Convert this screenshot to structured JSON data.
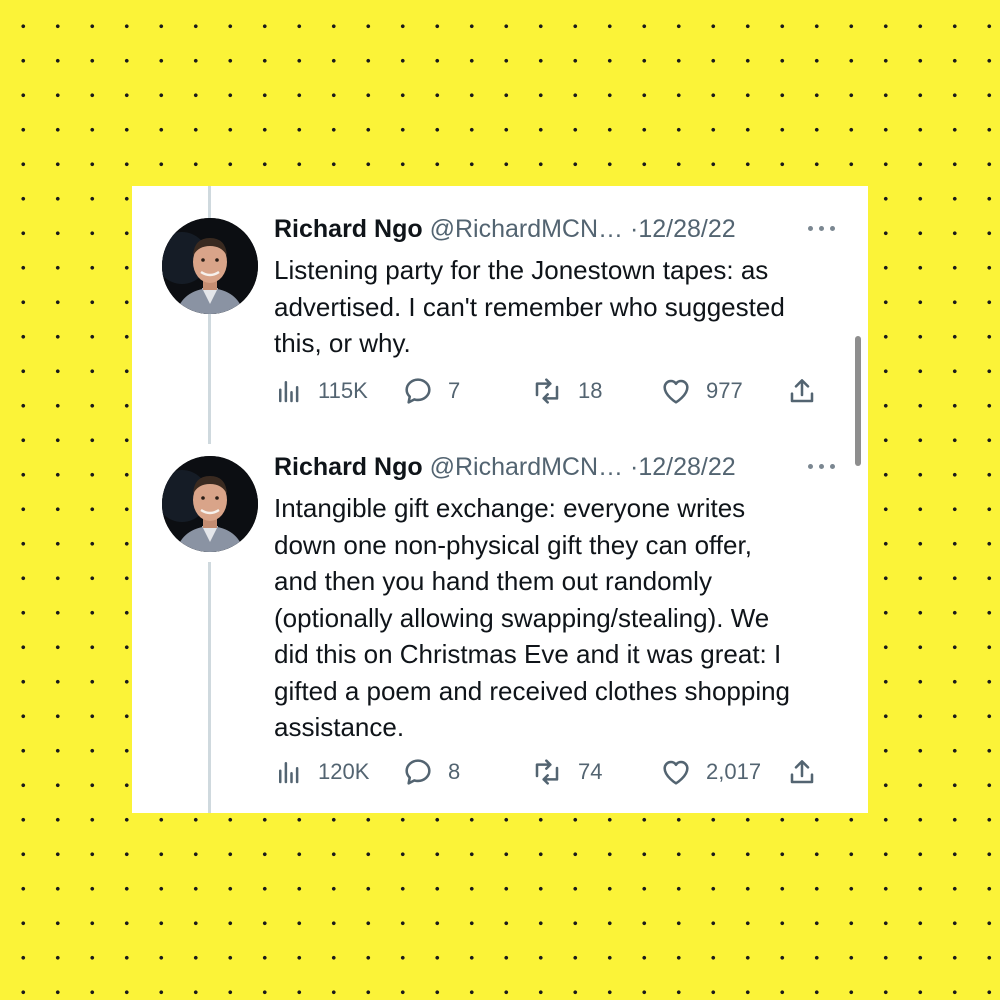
{
  "colors": {
    "background": "#fbf338",
    "card": "#ffffff",
    "text": "#0f1419",
    "secondary": "#536471",
    "thread_line": "#cfd9de"
  },
  "tweets": [
    {
      "author_name": "Richard Ngo",
      "handle": "@RichardMCN…",
      "separator": "·",
      "date": "12/28/22",
      "text": "Listening party for the Jonestown tapes: as\nadvertised. I can't remember who suggested\nthis, or why.",
      "views": "115K",
      "replies": "7",
      "retweets": "18",
      "likes": "977"
    },
    {
      "author_name": "Richard Ngo",
      "handle": "@RichardMCN…",
      "separator": "·",
      "date": "12/28/22",
      "text": "Intangible gift exchange: everyone writes\ndown one non-physical gift they can offer,\nand then you hand them out randomly\n(optionally allowing swapping/stealing). We\ndid this on Christmas Eve and it was great: I\ngifted a poem and received clothes shopping\nassistance.",
      "views": "120K",
      "replies": "8",
      "retweets": "74",
      "likes": "2,017"
    }
  ],
  "icons": {
    "views": "analytics-icon",
    "reply": "reply-bubble-icon",
    "retweet": "retweet-icon",
    "like": "heart-icon",
    "share": "share-icon",
    "more": "more-dots-icon"
  }
}
